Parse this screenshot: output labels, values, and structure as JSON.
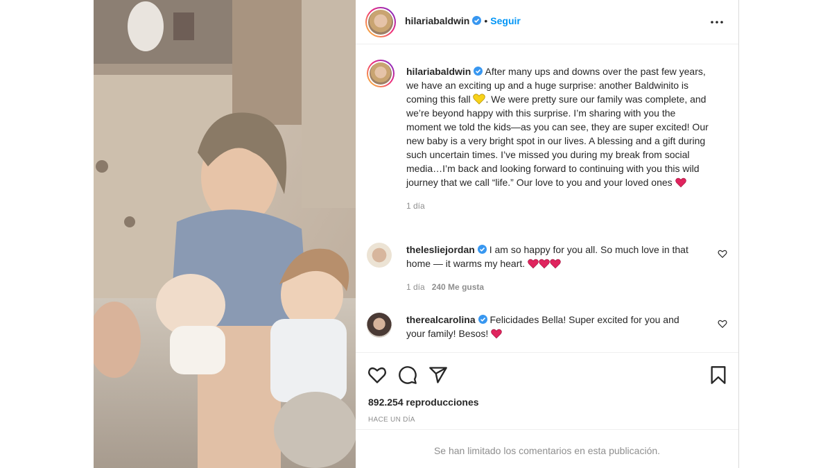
{
  "header": {
    "username": "hilariabaldwin",
    "separator": "•",
    "follow_label": "Seguir"
  },
  "caption": {
    "username": "hilariabaldwin",
    "text_part1": "After many ups and downs over the past few years, we have an exciting up and a huge surprise: another Baldwinito is coming this fall",
    "text_part2": ". We were pretty sure our family was complete, and we’re beyond happy with this surprise. I’m sharing with you the moment we told the kids—as you can see, they are super excited! Our new baby is a very bright spot in our lives. A blessing and a gift during such uncertain times. I’ve missed you during my break from social media…I’m back and looking forward to continuing with you this wild journey that we call “life.” Our love to you and your loved ones",
    "time": "1 día"
  },
  "comments": [
    {
      "username": "thelesliejordan",
      "text": "I am so happy for you all. So much love in that home — it warms my heart.",
      "time": "1 día",
      "likes": "240 Me gusta"
    },
    {
      "username": "therealcarolina",
      "text": "Felicidades Bella! Super excited for you and your family! Besos!"
    }
  ],
  "stats": {
    "views": "892.254 reproducciones",
    "posted": "HACE UN DÍA"
  },
  "footer": {
    "limited_comments": "Se han limitado los comentarios en esta publicación."
  },
  "icons": {
    "verified": "verified-badge-icon",
    "more": "more-options-icon",
    "like": "heart-icon",
    "comment": "comment-icon",
    "share": "share-icon",
    "save": "bookmark-icon"
  },
  "colors": {
    "link_blue": "#0095f6",
    "heart_red": "#e0245e",
    "yellow_heart": "#f7d21a",
    "muted_text": "#8e8e8e"
  }
}
